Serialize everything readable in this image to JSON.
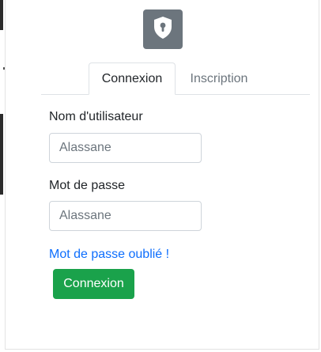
{
  "logo": {
    "icon": "shield-lock-icon",
    "color": "#6c757d"
  },
  "tabs": [
    {
      "label": "Connexion",
      "active": true
    },
    {
      "label": "Inscription",
      "active": false
    }
  ],
  "form": {
    "username_label": "Nom d'utilisateur",
    "username_placeholder": "Alassane",
    "password_label": "Mot de passe",
    "password_placeholder": "Alassane",
    "forgot_link": "Mot de passe oublié !",
    "submit_label": "Connexion"
  },
  "colors": {
    "submit_button": "#1aa24b",
    "link": "#0d6efd"
  }
}
